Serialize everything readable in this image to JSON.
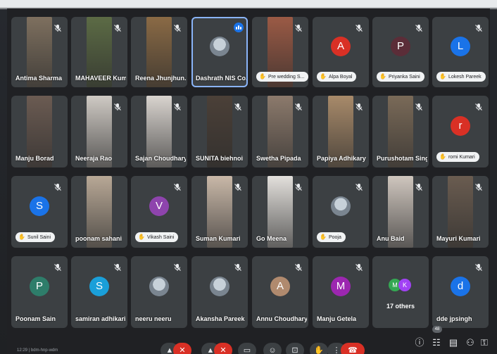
{
  "meeting": {
    "participant_count": "48",
    "footer_text": "12:29 | bdm-hnp-wdm"
  },
  "tiles": [
    {
      "row": 0,
      "col": 0,
      "label": "Antima Sharma",
      "label_style": "plain",
      "media": "video",
      "video_color": "#7e705f",
      "muted": true
    },
    {
      "row": 0,
      "col": 1,
      "label": "MAHAVEER Kum...",
      "label_style": "plain",
      "media": "video",
      "video_color": "#5c6b45",
      "muted": true
    },
    {
      "row": 0,
      "col": 2,
      "label": "Reena Jhunjhun...",
      "label_style": "plain",
      "media": "video",
      "video_color": "#8a6a45",
      "muted": true
    },
    {
      "row": 0,
      "col": 3,
      "label": "Dashrath NIS Co...",
      "label_style": "plain",
      "media": "photo",
      "muted": false,
      "speaking": true
    },
    {
      "row": 0,
      "col": 4,
      "label": "Pre wedding S...",
      "label_style": "chip",
      "media": "video",
      "video_color": "#9b5a45",
      "muted": true
    },
    {
      "row": 0,
      "col": 5,
      "label": "Alpa Boyal",
      "label_style": "chip",
      "media": "avatar",
      "avatar_letter": "A",
      "avatar_color": "#d93025",
      "muted": true
    },
    {
      "row": 0,
      "col": 6,
      "label": "Priyanka Saini",
      "label_style": "chip",
      "media": "avatar",
      "avatar_letter": "P",
      "avatar_color": "#5b2d38",
      "muted": true
    },
    {
      "row": 0,
      "col": 7,
      "label": "Lokesh Pareek",
      "label_style": "chip",
      "media": "avatar",
      "avatar_letter": "L",
      "avatar_color": "#1a73e8",
      "muted": true
    },
    {
      "row": 1,
      "col": 0,
      "label": "Manju Borad",
      "label_style": "plain",
      "media": "video",
      "video_color": "#6b5b52",
      "muted": false
    },
    {
      "row": 1,
      "col": 1,
      "label": "Neeraja Rao",
      "label_style": "plain",
      "media": "video",
      "video_color": "#cfcac4",
      "muted": true
    },
    {
      "row": 1,
      "col": 2,
      "label": "Sajan Choudhary",
      "label_style": "plain",
      "media": "video",
      "video_color": "#d9d4cf",
      "muted": true
    },
    {
      "row": 1,
      "col": 3,
      "label": "SUNITA biehnoi",
      "label_style": "plain",
      "media": "video",
      "video_color": "#4b4038",
      "muted": true
    },
    {
      "row": 1,
      "col": 4,
      "label": "Swetha Pipada",
      "label_style": "plain",
      "media": "video",
      "video_color": "#8c7a6c",
      "muted": true
    },
    {
      "row": 1,
      "col": 5,
      "label": "Papiya Adhikary",
      "label_style": "plain",
      "media": "video",
      "video_color": "#a88a6a",
      "muted": true
    },
    {
      "row": 1,
      "col": 6,
      "label": "Purushotam Singh",
      "label_style": "plain",
      "media": "video",
      "video_color": "#7a6a58",
      "muted": true
    },
    {
      "row": 1,
      "col": 7,
      "label": "romi Kumari",
      "label_style": "chip",
      "media": "avatar",
      "avatar_letter": "r",
      "avatar_color": "#d93025",
      "muted": true
    },
    {
      "row": 2,
      "col": 0,
      "label": "Sunil Saini",
      "label_style": "chip",
      "media": "avatar",
      "avatar_letter": "S",
      "avatar_color": "#1a73e8",
      "muted": true
    },
    {
      "row": 2,
      "col": 1,
      "label": "poonam sahani",
      "label_style": "plain",
      "media": "video",
      "video_color": "#b8a896",
      "muted": false
    },
    {
      "row": 2,
      "col": 2,
      "label": "Vikash Saini",
      "label_style": "chip",
      "media": "avatar",
      "avatar_letter": "V",
      "avatar_color": "#8e44ad",
      "muted": true
    },
    {
      "row": 2,
      "col": 3,
      "label": "Suman Kumari",
      "label_style": "plain",
      "media": "video",
      "video_color": "#c9b8a8",
      "muted": true
    },
    {
      "row": 2,
      "col": 4,
      "label": "Go Meena",
      "label_style": "plain",
      "media": "video",
      "video_color": "#e3e0dc",
      "muted": true
    },
    {
      "row": 2,
      "col": 5,
      "label": "Pooja",
      "label_style": "chip",
      "media": "photo",
      "muted": true
    },
    {
      "row": 2,
      "col": 6,
      "label": "Anu Baid",
      "label_style": "plain",
      "media": "video",
      "video_color": "#cfc6be",
      "muted": true
    },
    {
      "row": 2,
      "col": 7,
      "label": "Mayuri Kumari",
      "label_style": "plain",
      "media": "video",
      "video_color": "#6a5c50",
      "muted": true
    },
    {
      "row": 3,
      "col": 0,
      "label": "Poonam Sain",
      "label_style": "plain",
      "media": "avatar",
      "avatar_letter": "P",
      "avatar_color": "#2e7d6a",
      "muted": true
    },
    {
      "row": 3,
      "col": 1,
      "label": "samiran adhikari",
      "label_style": "plain",
      "media": "avatar",
      "avatar_letter": "S",
      "avatar_color": "#1a9fd9",
      "muted": true
    },
    {
      "row": 3,
      "col": 2,
      "label": "neeru neeru",
      "label_style": "plain",
      "media": "photo",
      "muted": true
    },
    {
      "row": 3,
      "col": 3,
      "label": "Akansha Pareek",
      "label_style": "plain",
      "media": "photo",
      "muted": true
    },
    {
      "row": 3,
      "col": 4,
      "label": "Annu Choudhary",
      "label_style": "plain",
      "media": "avatar",
      "avatar_letter": "A",
      "avatar_color": "#b08a6e",
      "muted": true
    },
    {
      "row": 3,
      "col": 5,
      "label": "Manju Getela",
      "label_style": "plain",
      "media": "avatar",
      "avatar_letter": "M",
      "avatar_color": "#9c27b0",
      "muted": true
    },
    {
      "row": 3,
      "col": 6,
      "label": "17 others",
      "label_style": "others",
      "media": "others",
      "mini_avatars": [
        {
          "letter": "M",
          "color": "#34a853"
        },
        {
          "letter": "K",
          "color": "#a142f4"
        }
      ],
      "muted": false
    },
    {
      "row": 3,
      "col": 7,
      "label": "dde jpsingh",
      "label_style": "plain",
      "media": "avatar",
      "avatar_letter": "d",
      "avatar_color": "#1a73e8",
      "muted": true
    }
  ],
  "controls": [
    {
      "name": "mic-toggle",
      "glyph": "▲"
    },
    {
      "name": "mic-off",
      "glyph": "✕",
      "red": true
    },
    {
      "name": "camera-toggle",
      "glyph": "▲"
    },
    {
      "name": "camera-off",
      "glyph": "✕",
      "red": true
    },
    {
      "name": "captions",
      "glyph": "▭"
    },
    {
      "name": "emoji",
      "glyph": "☺"
    },
    {
      "name": "present",
      "glyph": "⊡"
    },
    {
      "name": "raise-hand",
      "glyph": "✋"
    },
    {
      "name": "more-options",
      "glyph": "⋮"
    },
    {
      "name": "leave-call",
      "glyph": "☎",
      "red": true,
      "wide": true
    }
  ],
  "right_icons": [
    {
      "name": "info",
      "glyph": "ⓘ"
    },
    {
      "name": "people",
      "glyph": "☷"
    },
    {
      "name": "chat",
      "glyph": "▤"
    },
    {
      "name": "activities",
      "glyph": "⚇"
    },
    {
      "name": "host-controls",
      "glyph": "⚿"
    }
  ]
}
